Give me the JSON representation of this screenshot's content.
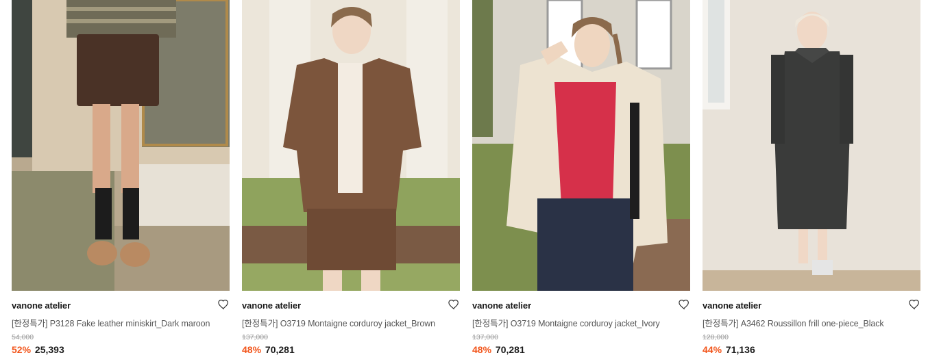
{
  "products": [
    {
      "brand": "vanone atelier",
      "name": "[한정특가] P3128 Fake leather miniskirt_Dark maroon",
      "original_price": "54,000",
      "discount": "52%",
      "sale_price": "25,393",
      "image_desc": "model-in-leather-miniskirt"
    },
    {
      "brand": "vanone atelier",
      "name": "[한정특가] O3719 Montaigne corduroy jacket_Brown",
      "original_price": "137,000",
      "discount": "48%",
      "sale_price": "70,281",
      "image_desc": "model-in-brown-corduroy-jacket"
    },
    {
      "brand": "vanone atelier",
      "name": "[한정특가] O3719 Montaigne corduroy jacket_Ivory",
      "original_price": "137,000",
      "discount": "48%",
      "sale_price": "70,281",
      "image_desc": "model-in-ivory-corduroy-jacket"
    },
    {
      "brand": "vanone atelier",
      "name": "[한정특가] A3462 Roussillon frill one-piece_Black",
      "original_price": "128,000",
      "discount": "44%",
      "sale_price": "71,136",
      "image_desc": "model-in-black-dress"
    }
  ],
  "colors": {
    "discount": "#f2551b",
    "price": "#1a1a1a",
    "original_price": "#9a9a9a"
  }
}
